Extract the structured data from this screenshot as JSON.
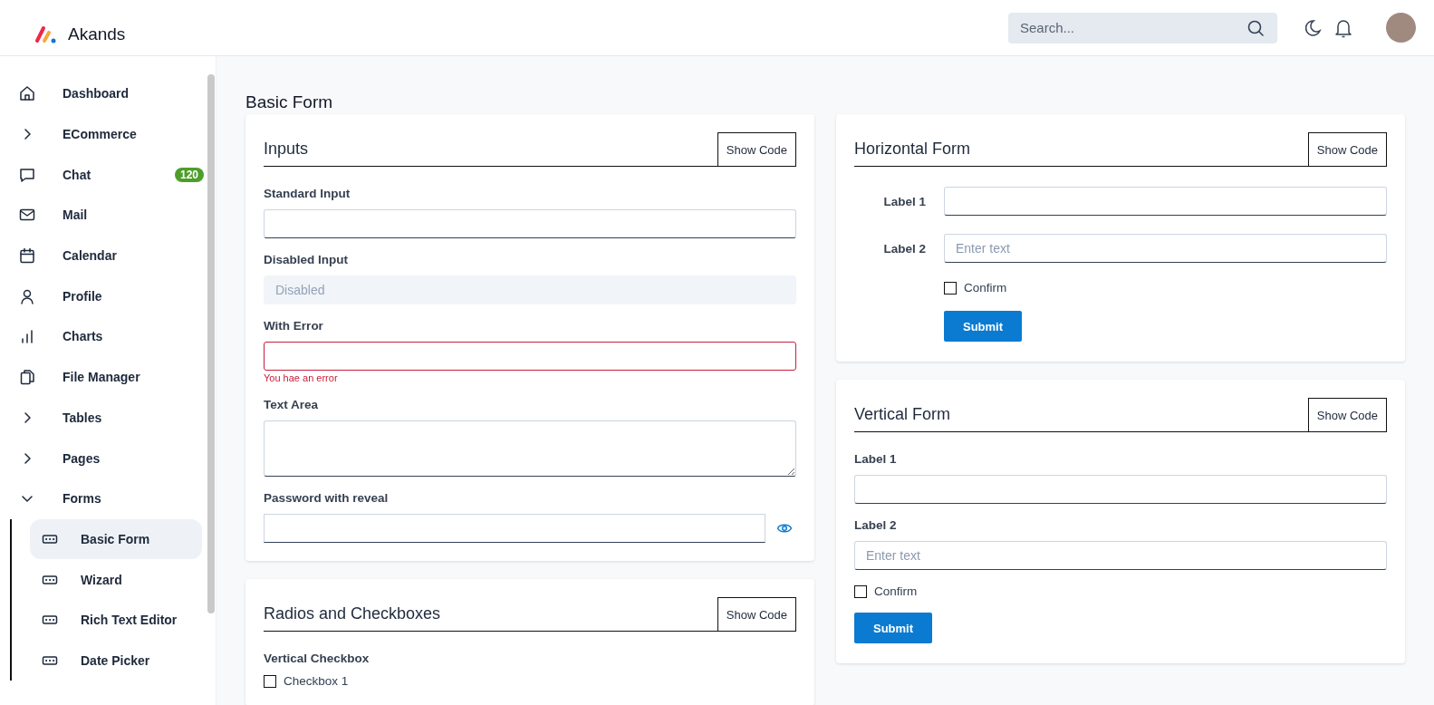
{
  "header": {
    "brand": "Akands",
    "search": {
      "placeholder": "Search..."
    }
  },
  "sidebar": {
    "items": [
      {
        "label": "Dashboard"
      },
      {
        "label": "ECommerce",
        "expanded": false
      },
      {
        "label": "Chat",
        "badge": "120"
      },
      {
        "label": "Mail"
      },
      {
        "label": "Calendar"
      },
      {
        "label": "Profile"
      },
      {
        "label": "Charts"
      },
      {
        "label": "File Manager"
      },
      {
        "label": "Tables",
        "expanded": false
      },
      {
        "label": "Pages",
        "expanded": false
      },
      {
        "label": "Forms",
        "expanded": true,
        "children": [
          {
            "label": "Basic Form",
            "selected": true
          },
          {
            "label": "Wizard",
            "selected": false
          },
          {
            "label": "Rich Text Editor",
            "selected": false
          },
          {
            "label": "Date Picker",
            "selected": false
          }
        ]
      }
    ]
  },
  "page_title": "Basic Form",
  "columns": [
    [
      {
        "title": "Inputs",
        "show_code": "Show Code",
        "kind": "vertical",
        "fields": [
          {
            "kind": "input",
            "label": "Standard Input"
          },
          {
            "kind": "input",
            "label": "Disabled Input",
            "value": "Disabled",
            "disabled": true
          },
          {
            "kind": "input",
            "label": "With Error",
            "invalid": true,
            "error": "You hae an error"
          },
          {
            "kind": "textarea",
            "label": "Text Area"
          },
          {
            "kind": "password",
            "label": "Password with reveal"
          }
        ]
      },
      {
        "title": "Radios and Checkboxes",
        "show_code": "Show Code",
        "kind": "vertical",
        "fields": [
          {
            "kind": "group_label",
            "label": "Vertical Checkbox"
          },
          {
            "kind": "checkbox",
            "label": "Checkbox 1",
            "checked": false
          }
        ]
      }
    ],
    [
      {
        "title": "Horizontal Form",
        "show_code": "Show Code",
        "kind": "horizontal",
        "fields": [
          {
            "kind": "input",
            "label": "Label 1"
          },
          {
            "kind": "input",
            "label": "Label 2",
            "placeholder": "Enter text"
          },
          {
            "kind": "checkbox",
            "label": "Confirm",
            "checked": false
          },
          {
            "kind": "submit",
            "label": "Submit"
          }
        ]
      },
      {
        "title": "Vertical Form",
        "show_code": "Show Code",
        "kind": "vertical",
        "fields": [
          {
            "kind": "input",
            "label": "Label 1"
          },
          {
            "kind": "input",
            "label": "Label 2",
            "placeholder": "Enter text"
          },
          {
            "kind": "checkbox",
            "label": "Confirm",
            "checked": false
          },
          {
            "kind": "submit",
            "label": "Submit"
          }
        ]
      }
    ]
  ]
}
